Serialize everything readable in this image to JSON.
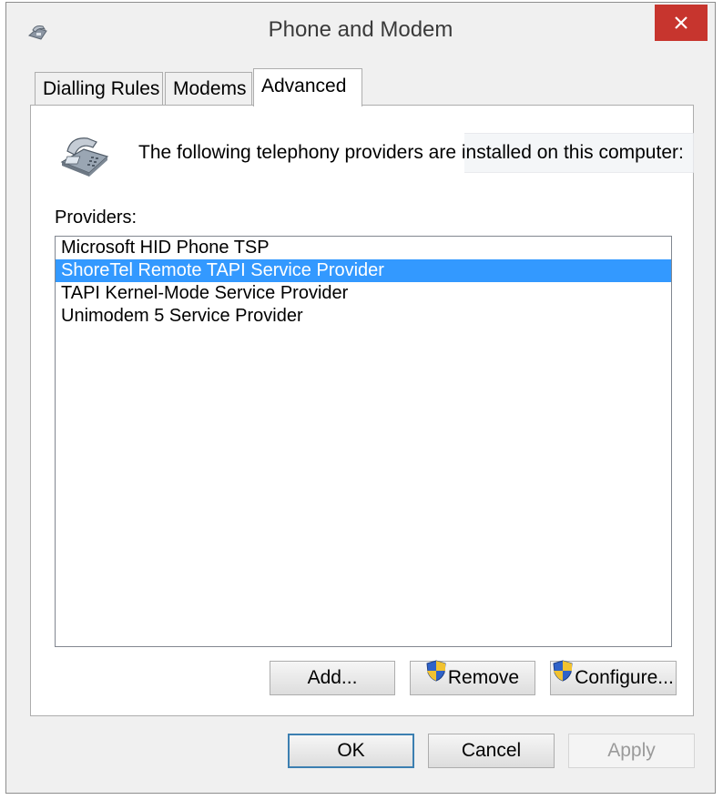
{
  "window": {
    "title": "Phone and Modem",
    "app_icon": "phone-modem-icon",
    "close_icon": "close-icon"
  },
  "tabs": [
    {
      "label": "Dialling Rules",
      "active": false
    },
    {
      "label": "Modems",
      "active": false
    },
    {
      "label": "Advanced",
      "active": true
    }
  ],
  "advanced": {
    "icon": "telephone-icon",
    "intro": "The following telephony providers are installed on this computer:",
    "providers_label": "Providers:",
    "providers": [
      {
        "name": "Microsoft HID Phone TSP",
        "selected": false
      },
      {
        "name": "ShoreTel Remote TAPI Service Provider",
        "selected": true
      },
      {
        "name": "TAPI Kernel-Mode Service Provider",
        "selected": false
      },
      {
        "name": "Unimodem 5 Service Provider",
        "selected": false
      }
    ],
    "add_label": "Add...",
    "remove_label": "Remove",
    "configure_label": "Configure...",
    "shield_icon": "uac-shield-icon"
  },
  "footer": {
    "ok_label": "OK",
    "cancel_label": "Cancel",
    "apply_label": "Apply",
    "apply_enabled": false
  },
  "colors": {
    "selection": "#3399ff",
    "close_button": "#c7352e",
    "default_button_border": "#3c7fb1"
  }
}
